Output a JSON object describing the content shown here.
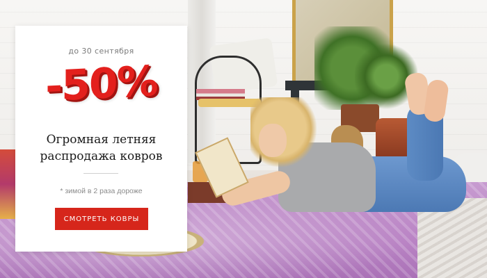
{
  "promo": {
    "date_text": "до 30 сентября",
    "discount": "-50%",
    "headline_line1": "Огромная летняя",
    "headline_line2": "распродажа ковров",
    "footnote": "* зимой в 2 раза дороже",
    "cta_label": "СМОТРЕТЬ КОВРЫ"
  },
  "colors": {
    "accent": "#e3201d",
    "button": "#d6261b",
    "card_background": "#ffffff"
  }
}
